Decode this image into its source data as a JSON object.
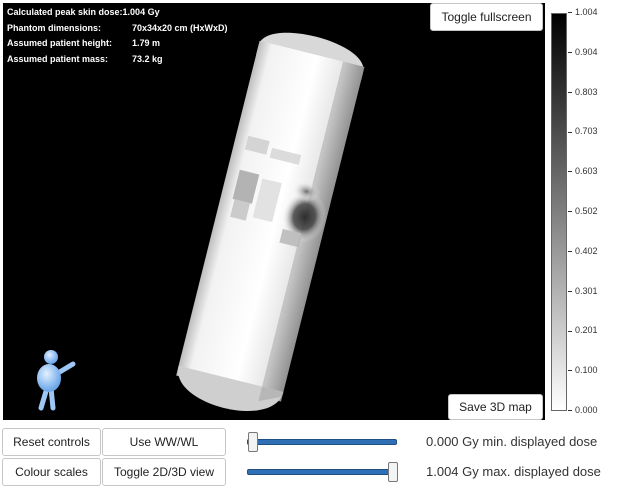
{
  "info": {
    "peak_dose_label": "Calculated peak skin dose:",
    "peak_dose_value": "1.004 Gy",
    "phantom_label": "Phantom dimensions:",
    "phantom_value": "70x34x20 cm (HxWxD)",
    "height_label": "Assumed patient height:",
    "height_value": "1.79 m",
    "mass_label": "Assumed patient mass:",
    "mass_value": "73.2 kg"
  },
  "buttons": {
    "fullscreen": "Toggle fullscreen",
    "save_map": "Save 3D map",
    "reset": "Reset controls",
    "use_wwwl": "Use WW/WL",
    "colour_scales": "Colour scales",
    "toggle_view": "Toggle 2D/3D view"
  },
  "colorbar": {
    "ticks": [
      "1.004",
      "0.904",
      "0.803",
      "0.703",
      "0.603",
      "0.502",
      "0.402",
      "0.301",
      "0.201",
      "0.100",
      "0.000"
    ]
  },
  "sliders": {
    "min_label": "0.000 Gy min. displayed dose",
    "max_label": "1.004 Gy max. displayed dose",
    "min_fraction": 0.0,
    "max_fraction": 1.0
  },
  "icons": {
    "orientation": "orientation-figure-icon"
  }
}
